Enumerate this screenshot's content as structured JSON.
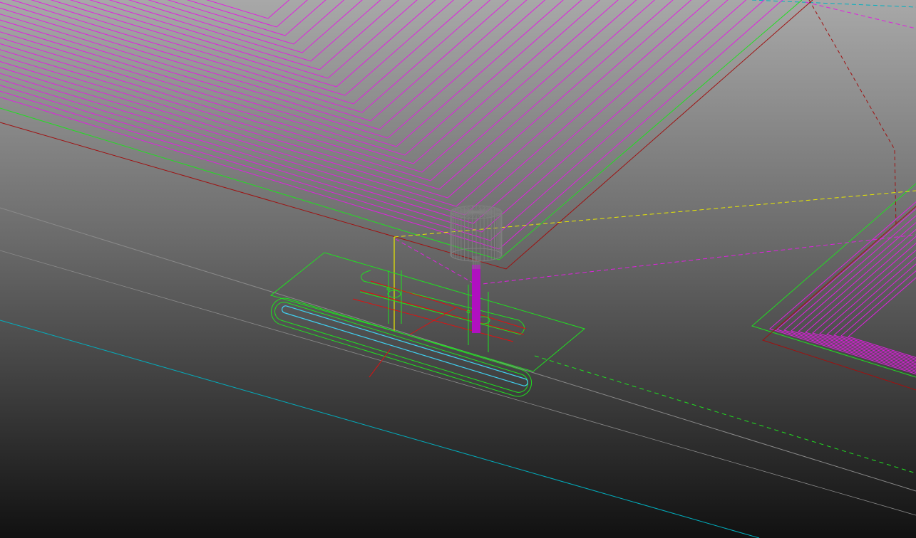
{
  "viewport": {
    "background_top": "#a8a8a8",
    "background_mid": "#6a6a6a",
    "background_bottom": "#111111"
  },
  "colors": {
    "toolpath": "#e020e0",
    "boundary_green": "#20e020",
    "stock_red": "#a01010",
    "rapid_yellow": "#e8e800",
    "reference_cyan": "#00b0c0",
    "feature_gray": "#8a8a8a",
    "slot_cyan": "#40d0f0",
    "fixture_red": "#e01010",
    "tool_shank": "#b010c0",
    "tool_cutter": "#808080"
  },
  "scene_objects": [
    "toolpath-large-pocket",
    "toolpath-right-pocket",
    "fixture-clamp-part",
    "cutting-tool",
    "rapid-move-link",
    "reference-lines"
  ]
}
